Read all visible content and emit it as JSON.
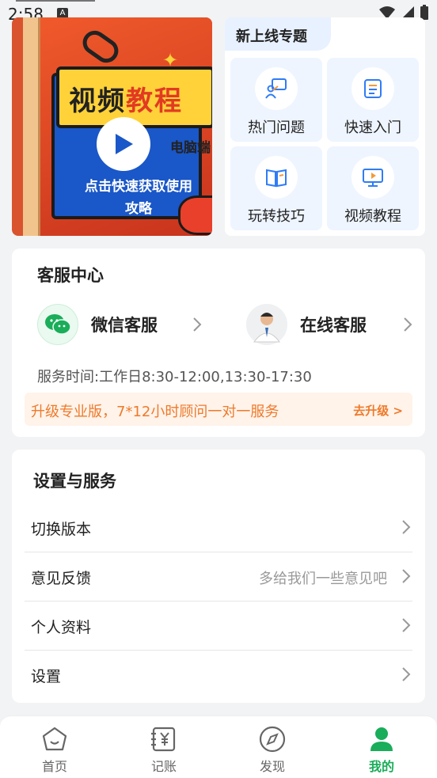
{
  "status": {
    "time": "2:58",
    "sim_label": "A"
  },
  "banner": {
    "title_part1": "视频",
    "title_part2": "教程",
    "tag": "电脑端",
    "hint": "点击快速获取使用攻略"
  },
  "topics": {
    "header": "新上线专题",
    "items": [
      {
        "label": "热门问题",
        "icon": "presenter-icon"
      },
      {
        "label": "快速入门",
        "icon": "list-doc-icon"
      },
      {
        "label": "玩转技巧",
        "icon": "open-book-icon"
      },
      {
        "label": "视频教程",
        "icon": "video-screen-icon"
      }
    ]
  },
  "customer_service": {
    "title": "客服中心",
    "wechat_label": "微信客服",
    "online_label": "在线客服",
    "hours": "服务时间:工作日8:30-12:00,13:30-17:30",
    "upgrade_text": "升级专业版，7*12小时顾问一对一服务",
    "upgrade_action": "去升级 >"
  },
  "settings": {
    "title": "设置与服务",
    "rows": [
      {
        "label": "切换版本",
        "hint": ""
      },
      {
        "label": "意见反馈",
        "hint": "多给我们一些意见吧"
      },
      {
        "label": "个人资料",
        "hint": ""
      },
      {
        "label": "设置",
        "hint": ""
      }
    ]
  },
  "tabbar": {
    "tabs": [
      {
        "label": "首页",
        "icon": "home-icon"
      },
      {
        "label": "记账",
        "icon": "ledger-icon"
      },
      {
        "label": "发现",
        "icon": "compass-icon"
      },
      {
        "label": "我的",
        "icon": "profile-icon",
        "active": true
      }
    ]
  },
  "colors": {
    "accent": "#1aad5a",
    "orange": "#ee7a2b",
    "blue": "#2f7cf6"
  }
}
